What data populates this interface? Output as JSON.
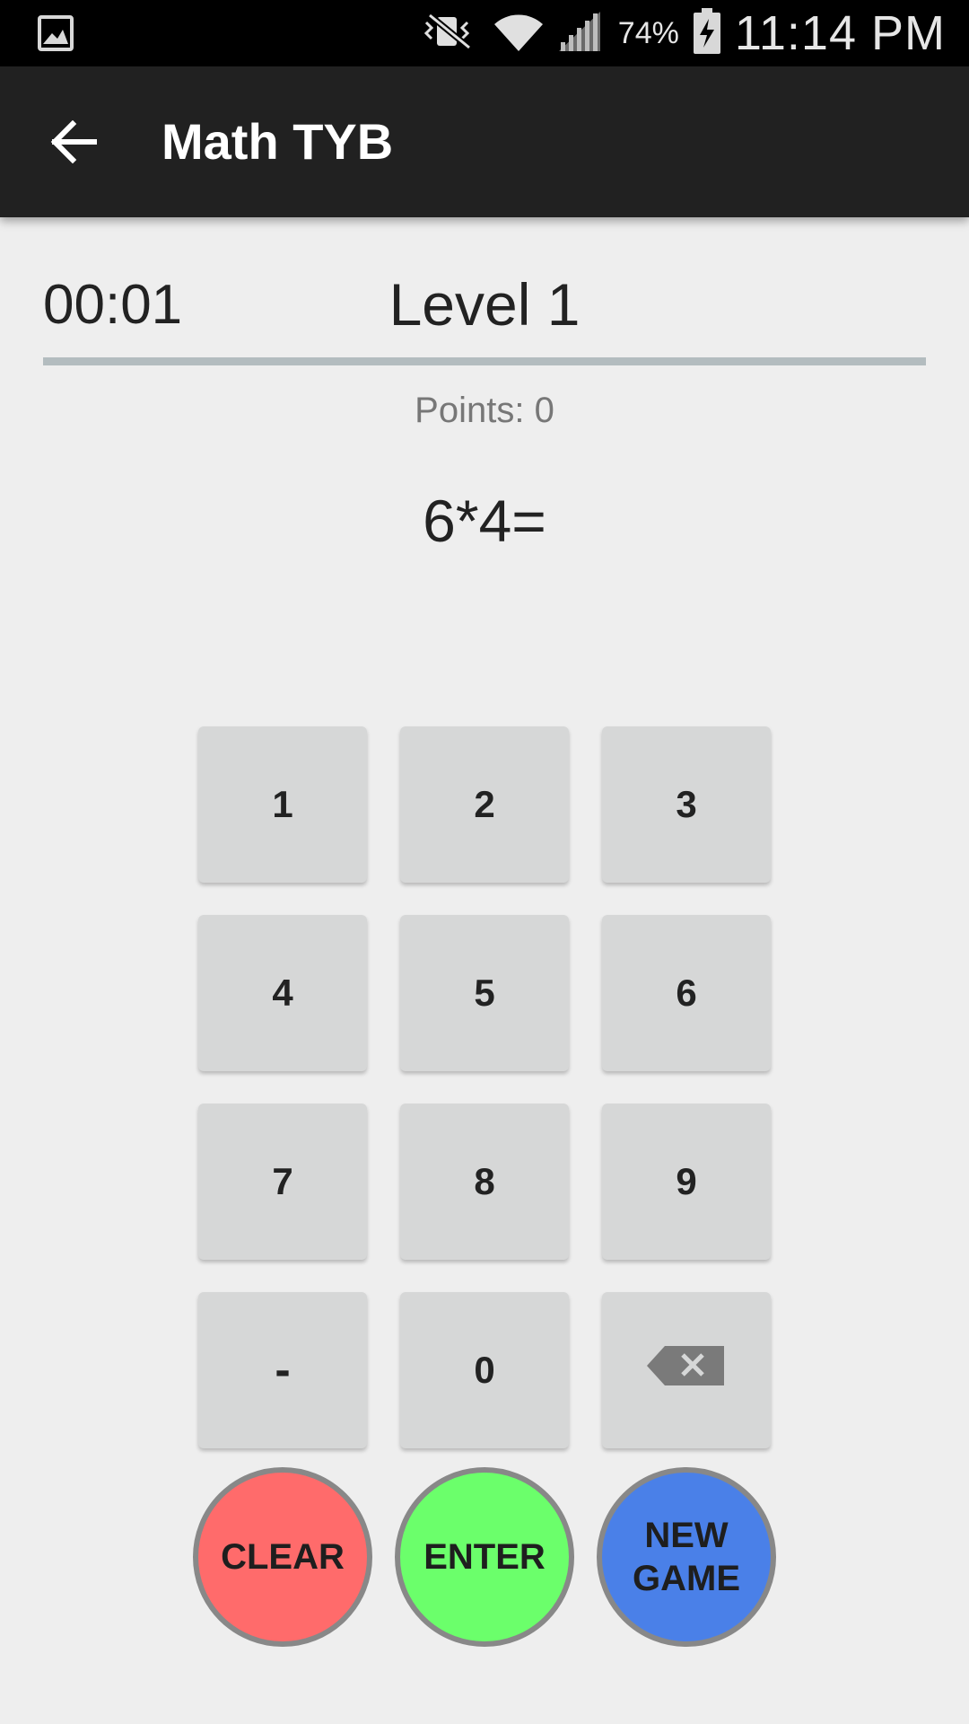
{
  "status_bar": {
    "battery_percent": "74%",
    "time": "11:14 PM",
    "icons": [
      "gallery-icon",
      "vibrate-mute-icon",
      "wifi-icon",
      "signal-icon",
      "battery-charging-icon"
    ]
  },
  "app_bar": {
    "title": "Math TYB",
    "back_icon": "arrow-left-icon"
  },
  "game": {
    "timer": "00:01",
    "level": "Level 1",
    "progress_fraction": 0.0,
    "points": "Points: 0",
    "question": "6*4="
  },
  "keypad": {
    "keys": [
      "1",
      "2",
      "3",
      "4",
      "5",
      "6",
      "7",
      "8",
      "9",
      "-",
      "0",
      "backspace-icon"
    ]
  },
  "actions": {
    "clear": "CLEAR",
    "enter": "ENTER",
    "new_game": "NEW\nGAME"
  },
  "colors": {
    "clear": "#ff6b6b",
    "enter": "#6bff6b",
    "new_game": "#4a80e8",
    "app_bar": "#212121",
    "key": "#d6d7d7"
  }
}
